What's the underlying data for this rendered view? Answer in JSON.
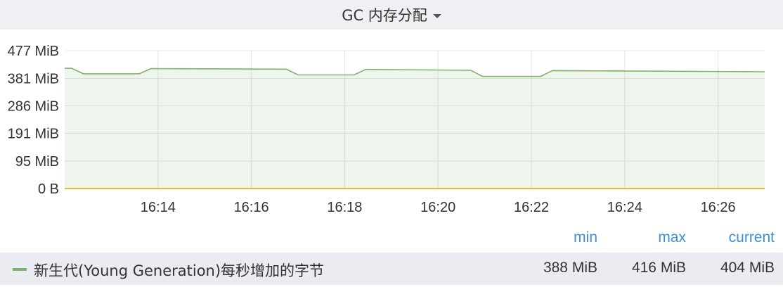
{
  "panel": {
    "title": "GC 内存分配"
  },
  "legend": {
    "headers": {
      "min": "min",
      "max": "max",
      "current": "current"
    },
    "series": [
      {
        "label": "新生代(Young Generation)每秒增加的字节",
        "min": "388 MiB",
        "max": "416 MiB",
        "current": "404 MiB",
        "color": "#7eb26d"
      }
    ]
  },
  "chart_data": {
    "type": "area",
    "title": "GC 内存分配",
    "y_tick_labels": [
      "0 B",
      "95 MiB",
      "191 MiB",
      "286 MiB",
      "381 MiB",
      "477 MiB"
    ],
    "y_ticks": [
      0,
      95,
      191,
      286,
      381,
      477
    ],
    "ylim": [
      0,
      477
    ],
    "x_tick_labels": [
      "16:14",
      "16:16",
      "16:18",
      "16:20",
      "16:22",
      "16:24",
      "16:26"
    ],
    "x_ticks": [
      14,
      16,
      18,
      20,
      22,
      24,
      26
    ],
    "xlim": [
      12.0,
      27.0
    ],
    "grid": true,
    "series": [
      {
        "name": "新生代(Young Generation)每秒增加的字节",
        "color": "#7eb26d",
        "x": [
          12.0,
          12.15,
          12.4,
          13.6,
          13.85,
          16.75,
          17.0,
          18.2,
          18.45,
          20.7,
          20.95,
          22.2,
          22.45,
          27.0
        ],
        "values": [
          416,
          416,
          397,
          397,
          415,
          413,
          393,
          393,
          412,
          409,
          388,
          388,
          408,
          404
        ]
      },
      {
        "name": "",
        "color": "#eab839",
        "x": [
          12.0,
          27.0
        ],
        "values": [
          0,
          0
        ]
      }
    ]
  }
}
